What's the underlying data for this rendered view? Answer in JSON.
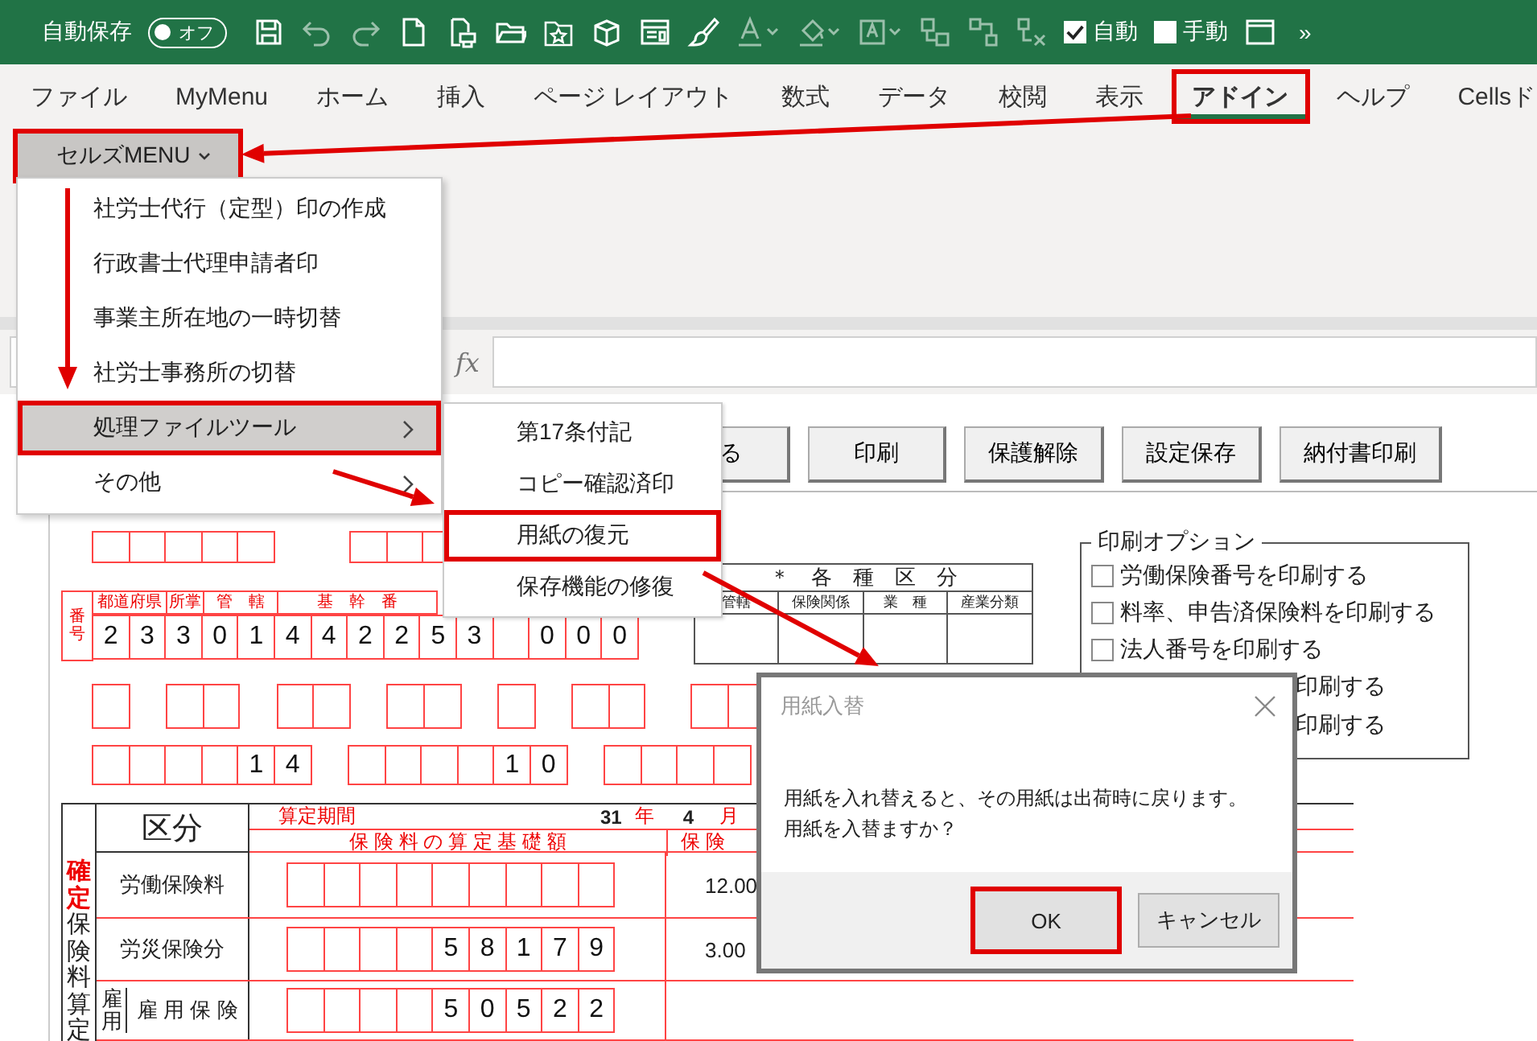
{
  "title_bar": {
    "autosave_label": "自動保存",
    "autosave": {
      "label": "オフ",
      "on": false
    },
    "checkboxes": [
      {
        "label": "自動",
        "checked": true
      },
      {
        "label": "手動",
        "checked": false
      }
    ],
    "overflow": "»"
  },
  "tabs": [
    {
      "label": "ファイル",
      "selected": false
    },
    {
      "label": "MyMenu",
      "selected": false
    },
    {
      "label": "ホーム",
      "selected": false
    },
    {
      "label": "挿入",
      "selected": false
    },
    {
      "label": "ページ レイアウト",
      "selected": false
    },
    {
      "label": "数式",
      "selected": false
    },
    {
      "label": "データ",
      "selected": false
    },
    {
      "label": "校閲",
      "selected": false
    },
    {
      "label": "表示",
      "selected": false
    },
    {
      "label": "アドイン",
      "selected": true
    },
    {
      "label": "ヘルプ",
      "selected": false
    },
    {
      "label": "Cellsド",
      "selected": false
    }
  ],
  "ribbon": {
    "menu_button": {
      "label": "セルズMENU",
      "highlighted": true
    }
  },
  "formula_bar": {
    "fx_label": "fx"
  },
  "sheet": {
    "buttons": [
      "る",
      "印刷",
      "保護解除",
      "設定保存",
      "納付書印刷"
    ],
    "number_headers": [
      "都道府県",
      "所掌",
      "管　轄",
      "基　幹　番"
    ],
    "number_side_label": "番号",
    "number_digits": [
      "2",
      "3",
      "3",
      "0",
      "1",
      "4",
      "4",
      "2",
      "2",
      "5",
      "3",
      "0",
      "0",
      "0"
    ],
    "code_row_digits": [
      "1",
      "4",
      "1",
      "0"
    ],
    "classification": {
      "title": "＊　各　種　区　分",
      "columns": [
        "管轄",
        "保険関係",
        "業　種",
        "産業分類"
      ]
    },
    "print_options": {
      "title": "印刷オプション",
      "options": [
        {
          "label": "労働保険番号を印刷する",
          "checked": false
        },
        {
          "label": "料率、申告済保険料を印刷する",
          "checked": false
        },
        {
          "label": "法人番号を印刷する",
          "checked": false
        },
        {
          "label": "印刷する"
        },
        {
          "label": "印刷する"
        }
      ]
    },
    "main_table": {
      "category_header": "区分",
      "period_label": "算定期間",
      "year": "31",
      "year_unit": "年",
      "month": "4",
      "month_unit": "月",
      "base_header": "保 険 料 の 算 定 基 礎 額",
      "rate_header": "保 険",
      "side_mark": "確定",
      "side_label": "保険料算定",
      "rows": [
        {
          "kind": "plain",
          "label": "労働保険料",
          "rate": "12.00"
        },
        {
          "kind": "plain",
          "label": "労災保険分",
          "digits": [
            "5",
            "8",
            "1",
            "7",
            "9"
          ],
          "rate": "3.00"
        },
        {
          "kind": "sub",
          "group": "雇用",
          "label": "雇 用 保 険",
          "digits": [
            "5",
            "0",
            "5",
            "2",
            "2"
          ]
        }
      ]
    }
  },
  "dropdown_menu": {
    "items": [
      {
        "label": "社労士代行（定型）印の作成",
        "submenu": false,
        "selected": false
      },
      {
        "label": "行政書士代理申請者印",
        "submenu": false,
        "selected": false
      },
      {
        "label": "事業主所在地の一時切替",
        "submenu": false,
        "selected": false
      },
      {
        "label": "社労士事務所の切替",
        "submenu": false,
        "selected": false
      },
      {
        "label": "処理ファイルツール",
        "submenu": true,
        "selected": true
      },
      {
        "label": "その他",
        "submenu": true,
        "selected": false
      }
    ]
  },
  "submenu": {
    "items": [
      {
        "label": "第17条付記",
        "selected": false
      },
      {
        "label": "コピー確認済印",
        "selected": false
      },
      {
        "label": "用紙の復元",
        "selected": true
      },
      {
        "label": "保存機能の修復",
        "selected": false
      }
    ]
  },
  "dialog": {
    "title": "用紙入替",
    "message": [
      "用紙を入れ替えると、その用紙は出荷時に戻ります。",
      "用紙を入替ますか？"
    ],
    "buttons": [
      {
        "label": "OK",
        "default": true
      },
      {
        "label": "キャンセル",
        "default": false
      }
    ]
  }
}
